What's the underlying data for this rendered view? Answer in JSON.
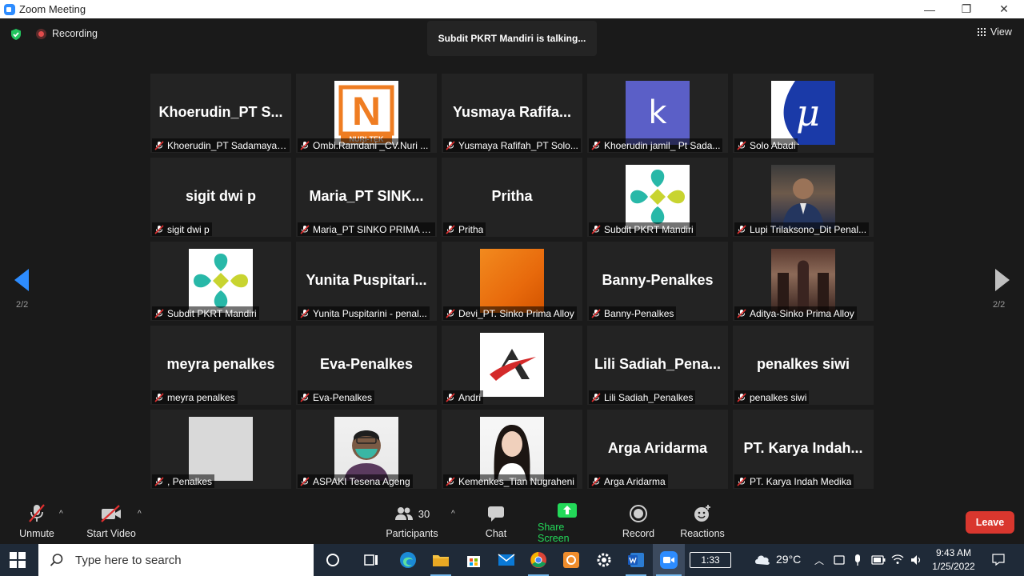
{
  "window": {
    "title": "Zoom Meeting",
    "minimize": "—",
    "restore": "❐",
    "close": "✕"
  },
  "meeting_bar": {
    "recording": "Recording",
    "talking": "Subdit PKRT Mandiri is talking...",
    "view": "View"
  },
  "pagination": {
    "left": "2/2",
    "right": "2/2"
  },
  "tiles": [
    {
      "big": "Khoerudin_PT S...",
      "label": "Khoerudin_PT Sadamaya ..."
    },
    {
      "big": "",
      "avatar": "nuritek-logo",
      "logo_text": "N",
      "logo_sub": "NURI-TEK",
      "label": "Ombi.Ramdani _CV.Nuri ..."
    },
    {
      "big": "Yusmaya Rafifa...",
      "label": "Yusmaya Rafifah_PT Solo..."
    },
    {
      "big": "",
      "avatar": "letter-k",
      "logo_text": "k",
      "label": "Khoerudin jamil_ Pt Sada..."
    },
    {
      "big": "",
      "avatar": "mu-logo",
      "logo_text": "μ",
      "label": "Solo Abadi"
    },
    {
      "big": "sigit dwi p",
      "label": "sigit dwi p"
    },
    {
      "big": "Maria_PT SINK...",
      "label": "Maria_PT SINKO PRIMA A..."
    },
    {
      "big": "Pritha",
      "label": "Pritha"
    },
    {
      "big": "",
      "avatar": "kemenkes-leaf",
      "label": "Subdit PKRT Mandiri"
    },
    {
      "big": "",
      "avatar": "photo-man",
      "label": "Lupi Trilaksono_Dit Penal..."
    },
    {
      "big": "",
      "avatar": "kemenkes-leaf",
      "label": "Subdit PKRT Mandiri"
    },
    {
      "big": "Yunita Puspitari...",
      "label": "Yunita Puspitarini - penal..."
    },
    {
      "big": "",
      "avatar": "orange-square",
      "label": "Devi_PT. Sinko Prima Alloy"
    },
    {
      "big": "Banny-Penalkes",
      "label": "Banny-Penalkes"
    },
    {
      "big": "",
      "avatar": "photo-church",
      "label": "Aditya-Sinko Prima Alloy"
    },
    {
      "big": "meyra penalkes",
      "label": "meyra penalkes"
    },
    {
      "big": "Eva-Penalkes",
      "label": "Eva-Penalkes"
    },
    {
      "big": "",
      "avatar": "a-logo",
      "label": "Andri"
    },
    {
      "big": "Lili Sadiah_Pena...",
      "label": "Lili Sadiah_Penalkes"
    },
    {
      "big": "penalkes siwi",
      "label": "penalkes siwi"
    },
    {
      "big": "",
      "avatar": "gray-square",
      "label": ", Penalkes"
    },
    {
      "big": "",
      "avatar": "photo-mask",
      "label": "ASPAKI Tesena Ageng"
    },
    {
      "big": "",
      "avatar": "photo-woman",
      "label": "Kemenkes_Tian Nugraheni"
    },
    {
      "big": "Arga Aridarma",
      "label": "Arga Aridarma"
    },
    {
      "big": "PT. Karya Indah...",
      "label": "PT. Karya Indah Medika"
    }
  ],
  "toolbar": {
    "unmute": "Unmute",
    "start_video": "Start Video",
    "participants": "Participants",
    "participants_count": "30",
    "chat": "Chat",
    "share_screen": "Share Screen",
    "record": "Record",
    "reactions": "Reactions",
    "leave": "Leave"
  },
  "taskbar": {
    "search_placeholder": "Type here to search",
    "app_clock": "1:33",
    "temperature": "29°C",
    "time": "9:43 AM",
    "date": "1/25/2022"
  },
  "colors": {
    "accent": "#2d8cff",
    "share_green": "#23d959",
    "leave_red": "#d9372e",
    "tile_bg": "#232323"
  }
}
